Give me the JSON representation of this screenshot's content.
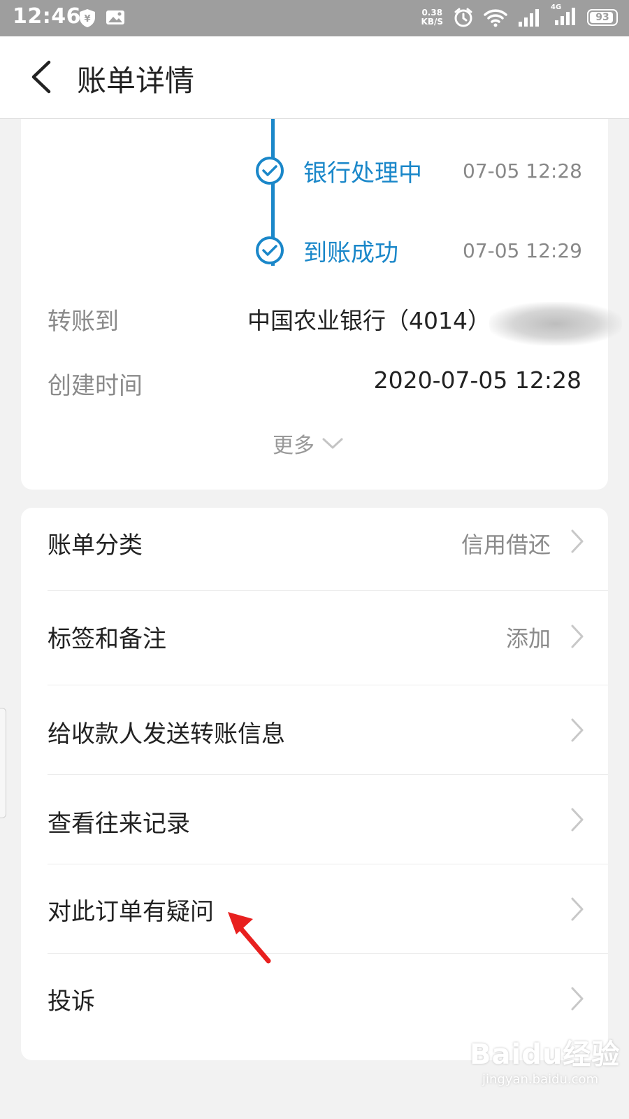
{
  "status_bar": {
    "time": "12:46",
    "net_speed_value": "0.38",
    "net_speed_unit": "KB/S",
    "network": "4G",
    "battery": "93",
    "battery_level_percent": 93
  },
  "header": {
    "title": "账单详情"
  },
  "timeline": [
    {
      "label": "银行处理中",
      "time": "07-05 12:28"
    },
    {
      "label": "到账成功",
      "time": "07-05 12:29"
    }
  ],
  "details": {
    "transfer_to_label": "转账到",
    "transfer_to_value": "中国农业银行（4014）",
    "created_label": "创建时间",
    "created_value": "2020-07-05 12:28",
    "more_label": "更多"
  },
  "menu": {
    "category_label": "账单分类",
    "category_value": "信用借还",
    "tags_label": "标签和备注",
    "tags_value": "添加",
    "send_info_label": "给收款人发送转账信息",
    "history_label": "查看往来记录",
    "question_label": "对此订单有疑问",
    "complain_label": "投诉"
  },
  "watermark": {
    "logo": "Baidu经验",
    "site": "jingyan.baidu.com"
  },
  "colors": {
    "accent": "#1a87c9",
    "status_bar": "#9e9e9e",
    "annotation_arrow": "#e8201f"
  }
}
